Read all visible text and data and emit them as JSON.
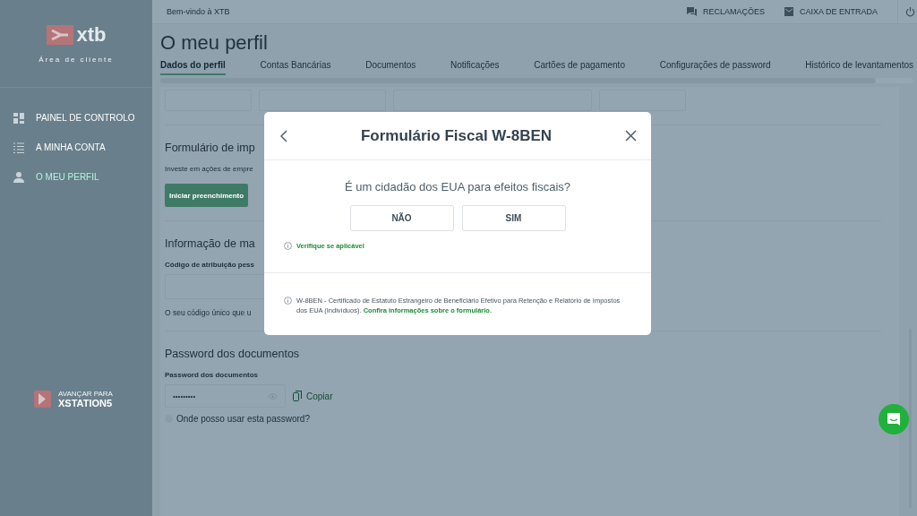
{
  "top_bar": {
    "welcome": "Bem-vindo à XTB",
    "links": [
      {
        "label": "RECLAMAÇÕES",
        "kind": "chat"
      },
      {
        "label": "CAIXA DE ENTRADA",
        "kind": "mail"
      }
    ]
  },
  "sidebar": {
    "logo": "xtb",
    "subtitle": "Área de cliente",
    "items": [
      {
        "label": "PAINEL DE CONTROLO",
        "kind": "dashboard",
        "selected": false
      },
      {
        "label": "A MINHA CONTA",
        "kind": "list",
        "selected": false
      },
      {
        "label": "O MEU PERFIL",
        "kind": "person",
        "selected": true
      }
    ],
    "promo": {
      "caption": "AVANÇAR PARA",
      "name": "XSTATION5"
    }
  },
  "page": {
    "title": "O meu perfil",
    "tabs": [
      {
        "label": "Dados do perfil",
        "selected": true
      },
      {
        "label": "Contas Bancárias",
        "selected": false
      },
      {
        "label": "Documentos",
        "selected": false
      },
      {
        "label": "Notificações",
        "selected": false
      },
      {
        "label": "Cartões de pagamento",
        "selected": false
      },
      {
        "label": "Configurações de password",
        "selected": false
      },
      {
        "label": "Histórico de levantamentos",
        "selected": false
      }
    ]
  },
  "tax_form": {
    "heading": "Formulário de imp",
    "text": "Investe em ações de empre",
    "button": "Iniciar preenchimento"
  },
  "marketing": {
    "heading": "Informação de ma",
    "label": "Código de atribuição pess",
    "hint": "O seu código único que u"
  },
  "doc_password": {
    "heading": "Password dos documentos",
    "label": "Password dos documentos",
    "value": "•••••••••",
    "copy": "Copiar",
    "help": "Onde posso usar esta password?"
  },
  "modal": {
    "title": "Formulário Fiscal W-8BEN",
    "question": "É um cidadão dos EUA para efeitos fiscais?",
    "options": [
      {
        "label": "NÃO",
        "selected": false
      },
      {
        "label": "SIM",
        "selected": false
      }
    ],
    "note": "Verifique se aplicável",
    "footer": "W-8BEN - Certificado de Estatuto Estrangeiro de Beneficiário Efetivo para Retenção e Relatório de Impostos dos EUA (Indivíduos).",
    "footer_link": "Confira informações sobre o formulário."
  }
}
